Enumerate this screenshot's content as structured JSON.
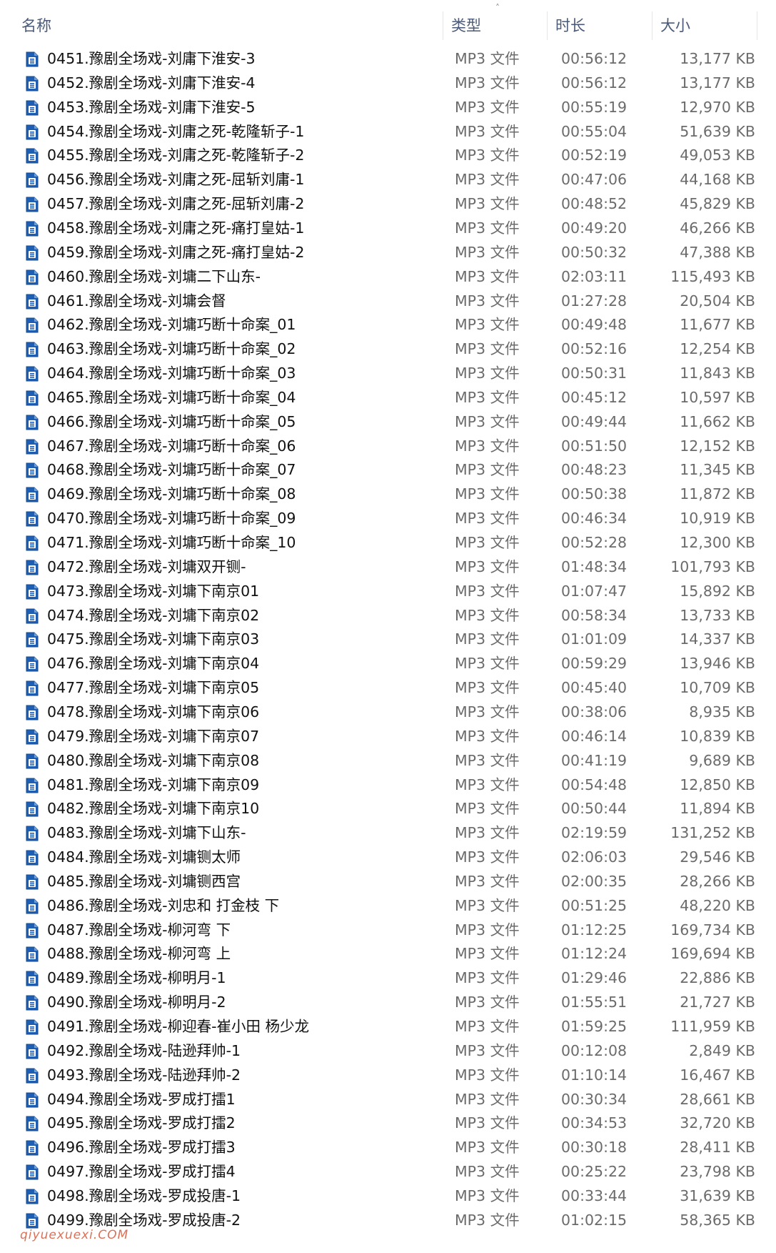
{
  "header": {
    "name_label": "名称",
    "type_label": "类型",
    "duration_label": "时长",
    "size_label": "大小",
    "sort_indicator": "˄"
  },
  "icon": "audio-file-icon",
  "colors": {
    "icon_blue": "#1e5fb4",
    "header_text": "#4a5a78",
    "watermark": "#d0411f"
  },
  "files": [
    {
      "name": "0451.豫剧全场戏-刘庸下淮安-3",
      "type": "MP3 文件",
      "duration": "00:56:12",
      "size": "13,177 KB"
    },
    {
      "name": "0452.豫剧全场戏-刘庸下淮安-4",
      "type": "MP3 文件",
      "duration": "00:56:12",
      "size": "13,177 KB"
    },
    {
      "name": "0453.豫剧全场戏-刘庸下淮安-5",
      "type": "MP3 文件",
      "duration": "00:55:19",
      "size": "12,970 KB"
    },
    {
      "name": "0454.豫剧全场戏-刘庸之死-乾隆斩子-1",
      "type": "MP3 文件",
      "duration": "00:55:04",
      "size": "51,639 KB"
    },
    {
      "name": "0455.豫剧全场戏-刘庸之死-乾隆斩子-2",
      "type": "MP3 文件",
      "duration": "00:52:19",
      "size": "49,053 KB"
    },
    {
      "name": "0456.豫剧全场戏-刘庸之死-屈斩刘庸-1",
      "type": "MP3 文件",
      "duration": "00:47:06",
      "size": "44,168 KB"
    },
    {
      "name": "0457.豫剧全场戏-刘庸之死-屈斩刘庸-2",
      "type": "MP3 文件",
      "duration": "00:48:52",
      "size": "45,829 KB"
    },
    {
      "name": "0458.豫剧全场戏-刘庸之死-痛打皇姑-1",
      "type": "MP3 文件",
      "duration": "00:49:20",
      "size": "46,266 KB"
    },
    {
      "name": "0459.豫剧全场戏-刘庸之死-痛打皇姑-2",
      "type": "MP3 文件",
      "duration": "00:50:32",
      "size": "47,388 KB"
    },
    {
      "name": "0460.豫剧全场戏-刘墉二下山东-",
      "type": "MP3 文件",
      "duration": "02:03:11",
      "size": "115,493 KB"
    },
    {
      "name": "0461.豫剧全场戏-刘墉会督",
      "type": "MP3 文件",
      "duration": "01:27:28",
      "size": "20,504 KB"
    },
    {
      "name": "0462.豫剧全场戏-刘墉巧断十命案_01",
      "type": "MP3 文件",
      "duration": "00:49:48",
      "size": "11,677 KB"
    },
    {
      "name": "0463.豫剧全场戏-刘墉巧断十命案_02",
      "type": "MP3 文件",
      "duration": "00:52:16",
      "size": "12,254 KB"
    },
    {
      "name": "0464.豫剧全场戏-刘墉巧断十命案_03",
      "type": "MP3 文件",
      "duration": "00:50:31",
      "size": "11,843 KB"
    },
    {
      "name": "0465.豫剧全场戏-刘墉巧断十命案_04",
      "type": "MP3 文件",
      "duration": "00:45:12",
      "size": "10,597 KB"
    },
    {
      "name": "0466.豫剧全场戏-刘墉巧断十命案_05",
      "type": "MP3 文件",
      "duration": "00:49:44",
      "size": "11,662 KB"
    },
    {
      "name": "0467.豫剧全场戏-刘墉巧断十命案_06",
      "type": "MP3 文件",
      "duration": "00:51:50",
      "size": "12,152 KB"
    },
    {
      "name": "0468.豫剧全场戏-刘墉巧断十命案_07",
      "type": "MP3 文件",
      "duration": "00:48:23",
      "size": "11,345 KB"
    },
    {
      "name": "0469.豫剧全场戏-刘墉巧断十命案_08",
      "type": "MP3 文件",
      "duration": "00:50:38",
      "size": "11,872 KB"
    },
    {
      "name": "0470.豫剧全场戏-刘墉巧断十命案_09",
      "type": "MP3 文件",
      "duration": "00:46:34",
      "size": "10,919 KB"
    },
    {
      "name": "0471.豫剧全场戏-刘墉巧断十命案_10",
      "type": "MP3 文件",
      "duration": "00:52:28",
      "size": "12,300 KB"
    },
    {
      "name": "0472.豫剧全场戏-刘墉双开铡-",
      "type": "MP3 文件",
      "duration": "01:48:34",
      "size": "101,793 KB"
    },
    {
      "name": "0473.豫剧全场戏-刘墉下南京01",
      "type": "MP3 文件",
      "duration": "01:07:47",
      "size": "15,892 KB"
    },
    {
      "name": "0474.豫剧全场戏-刘墉下南京02",
      "type": "MP3 文件",
      "duration": "00:58:34",
      "size": "13,733 KB"
    },
    {
      "name": "0475.豫剧全场戏-刘墉下南京03",
      "type": "MP3 文件",
      "duration": "01:01:09",
      "size": "14,337 KB"
    },
    {
      "name": "0476.豫剧全场戏-刘墉下南京04",
      "type": "MP3 文件",
      "duration": "00:59:29",
      "size": "13,946 KB"
    },
    {
      "name": "0477.豫剧全场戏-刘墉下南京05",
      "type": "MP3 文件",
      "duration": "00:45:40",
      "size": "10,709 KB"
    },
    {
      "name": "0478.豫剧全场戏-刘墉下南京06",
      "type": "MP3 文件",
      "duration": "00:38:06",
      "size": "8,935 KB"
    },
    {
      "name": "0479.豫剧全场戏-刘墉下南京07",
      "type": "MP3 文件",
      "duration": "00:46:14",
      "size": "10,839 KB"
    },
    {
      "name": "0480.豫剧全场戏-刘墉下南京08",
      "type": "MP3 文件",
      "duration": "00:41:19",
      "size": "9,689 KB"
    },
    {
      "name": "0481.豫剧全场戏-刘墉下南京09",
      "type": "MP3 文件",
      "duration": "00:54:48",
      "size": "12,850 KB"
    },
    {
      "name": "0482.豫剧全场戏-刘墉下南京10",
      "type": "MP3 文件",
      "duration": "00:50:44",
      "size": "11,894 KB"
    },
    {
      "name": "0483.豫剧全场戏-刘墉下山东-",
      "type": "MP3 文件",
      "duration": "02:19:59",
      "size": "131,252 KB"
    },
    {
      "name": "0484.豫剧全场戏-刘墉铡太师",
      "type": "MP3 文件",
      "duration": "02:06:03",
      "size": "29,546 KB"
    },
    {
      "name": "0485.豫剧全场戏-刘墉铡西宫",
      "type": "MP3 文件",
      "duration": "02:00:35",
      "size": "28,266 KB"
    },
    {
      "name": "0486.豫剧全场戏-刘忠和 打金枝 下",
      "type": "MP3 文件",
      "duration": "00:51:25",
      "size": "48,220 KB"
    },
    {
      "name": "0487.豫剧全场戏-柳河弯  下",
      "type": "MP3 文件",
      "duration": "01:12:25",
      "size": "169,734 KB"
    },
    {
      "name": "0488.豫剧全场戏-柳河弯 上",
      "type": "MP3 文件",
      "duration": "01:12:24",
      "size": "169,694 KB"
    },
    {
      "name": "0489.豫剧全场戏-柳明月-1",
      "type": "MP3 文件",
      "duration": "01:29:46",
      "size": "22,886 KB"
    },
    {
      "name": "0490.豫剧全场戏-柳明月-2",
      "type": "MP3 文件",
      "duration": "01:55:51",
      "size": "21,727 KB"
    },
    {
      "name": "0491.豫剧全场戏-柳迎春-崔小田 杨少龙",
      "type": "MP3 文件",
      "duration": "01:59:25",
      "size": "111,959 KB"
    },
    {
      "name": "0492.豫剧全场戏-陆逊拜帅-1",
      "type": "MP3 文件",
      "duration": "00:12:08",
      "size": "2,849 KB"
    },
    {
      "name": "0493.豫剧全场戏-陆逊拜帅-2",
      "type": "MP3 文件",
      "duration": "01:10:14",
      "size": "16,467 KB"
    },
    {
      "name": "0494.豫剧全场戏-罗成打擂1",
      "type": "MP3 文件",
      "duration": "00:30:34",
      "size": "28,661 KB"
    },
    {
      "name": "0495.豫剧全场戏-罗成打擂2",
      "type": "MP3 文件",
      "duration": "00:34:53",
      "size": "32,720 KB"
    },
    {
      "name": "0496.豫剧全场戏-罗成打擂3",
      "type": "MP3 文件",
      "duration": "00:30:18",
      "size": "28,411 KB"
    },
    {
      "name": "0497.豫剧全场戏-罗成打擂4",
      "type": "MP3 文件",
      "duration": "00:25:22",
      "size": "23,798 KB"
    },
    {
      "name": "0498.豫剧全场戏-罗成投唐-1",
      "type": "MP3 文件",
      "duration": "00:33:44",
      "size": "31,639 KB"
    },
    {
      "name": "0499.豫剧全场戏-罗成投唐-2",
      "type": "MP3 文件",
      "duration": "01:02:15",
      "size": "58,365 KB"
    }
  ],
  "watermark_text": "qiyuexuexi.COM"
}
